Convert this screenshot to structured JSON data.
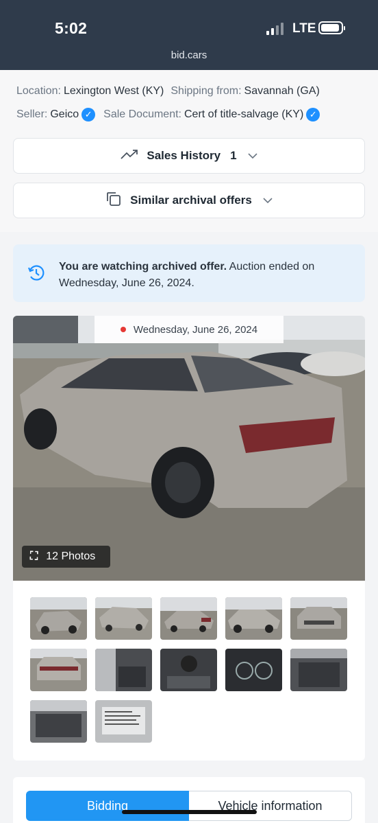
{
  "status_bar": {
    "time": "5:02",
    "network": "LTE",
    "url": "bid.cars"
  },
  "details": {
    "location_label": "Location:",
    "location_value": "Lexington West (KY)",
    "shipping_label": "Shipping from:",
    "shipping_value": "Savannah (GA)",
    "seller_label": "Seller:",
    "seller_value": "Geico",
    "sale_doc_label": "Sale Document:",
    "sale_doc_value": "Cert of title-salvage (KY)",
    "verified_icon": "check-badge-icon"
  },
  "sales_history": {
    "label": "Sales History",
    "count": "1",
    "icon": "trending-up-icon"
  },
  "similar": {
    "label": "Similar archival offers",
    "icon": "copy-icon"
  },
  "notice": {
    "bold": "You are watching archived offer.",
    "text": " Auction ended on Wednesday, June 26, 2024.",
    "icon": "history-icon"
  },
  "gallery": {
    "date": "Wednesday, June 26, 2024",
    "photos_label": "12 Photos",
    "photo_count": 12,
    "thumbnail_count": 12
  },
  "tabs": {
    "bidding": "Bidding",
    "vehicle": "Vehicle information"
  },
  "colors": {
    "header_bg": "#2f3b4b",
    "accent": "#2196f3",
    "notice_bg": "#e6f1fb",
    "live_dot": "#e53935"
  }
}
